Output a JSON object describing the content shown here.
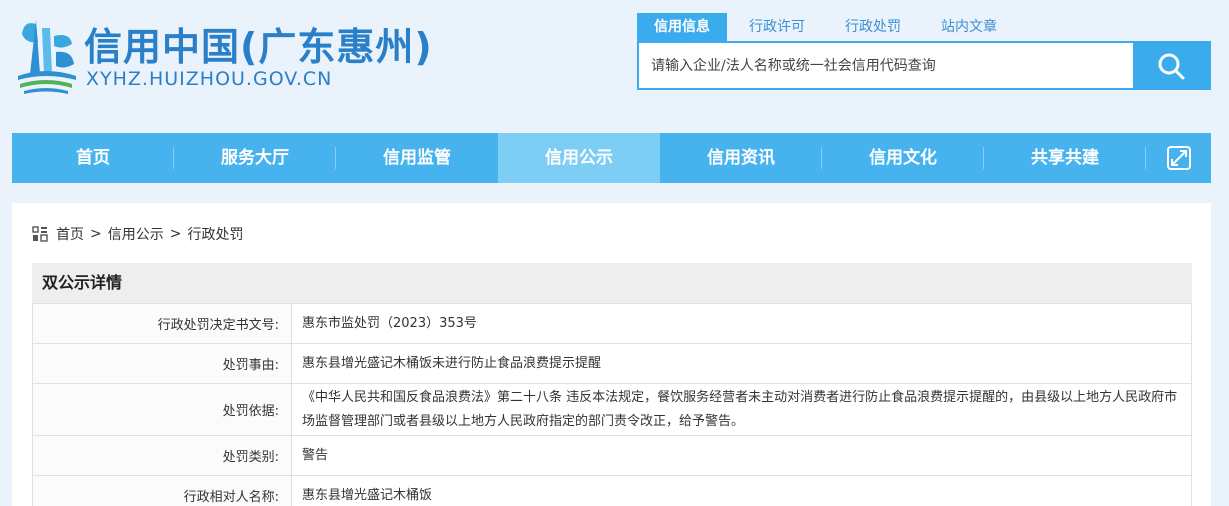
{
  "header": {
    "site_title": "信用中国(广东惠州)",
    "site_domain": "XYHZ.HUIZHOU.GOV.CN"
  },
  "search": {
    "tabs": [
      {
        "label": "信用信息",
        "active": true
      },
      {
        "label": "行政许可",
        "active": false
      },
      {
        "label": "行政处罚",
        "active": false
      },
      {
        "label": "站内文章",
        "active": false
      }
    ],
    "placeholder": "请输入企业/法人名称或统一社会信用代码查询"
  },
  "nav": {
    "items": [
      {
        "label": "首页"
      },
      {
        "label": "服务大厅"
      },
      {
        "label": "信用监管"
      },
      {
        "label": "信用公示",
        "active": true
      },
      {
        "label": "信用资讯"
      },
      {
        "label": "信用文化"
      },
      {
        "label": "共享共建"
      }
    ]
  },
  "breadcrumb": [
    "首页",
    "信用公示",
    "行政处罚"
  ],
  "detail": {
    "title": "双公示详情",
    "rows": [
      {
        "key": "行政处罚决定书文号:",
        "value": "惠东市监处罚（2023）353号"
      },
      {
        "key": "处罚事由:",
        "value": "惠东县增光盛记木桶饭未进行防止食品浪费提示提醒"
      },
      {
        "key": "处罚依据:",
        "value": "《中华人民共和国反食品浪费法》第二十八条 违反本法规定，餐饮服务经营者未主动对消费者进行防止食品浪费提示提醒的，由县级以上地方人民政府市场监督管理部门或者县级以上地方人民政府指定的部门责令改正，给予警告。"
      },
      {
        "key": "处罚类别:",
        "value": "警告"
      },
      {
        "key": "行政相对人名称:",
        "value": "惠东县增光盛记木桶饭"
      }
    ]
  },
  "colors": {
    "brand_blue": "#2a7fc9",
    "nav_bg": "#47b3ee",
    "nav_active": "#7ecdf5",
    "search_accent": "#3aabec",
    "page_bg": "#eaf3fb"
  },
  "icons": {
    "logo": "huizhou-logo-icon",
    "search": "search-icon",
    "expand": "expand-icon",
    "breadcrumb": "grid-icon"
  }
}
